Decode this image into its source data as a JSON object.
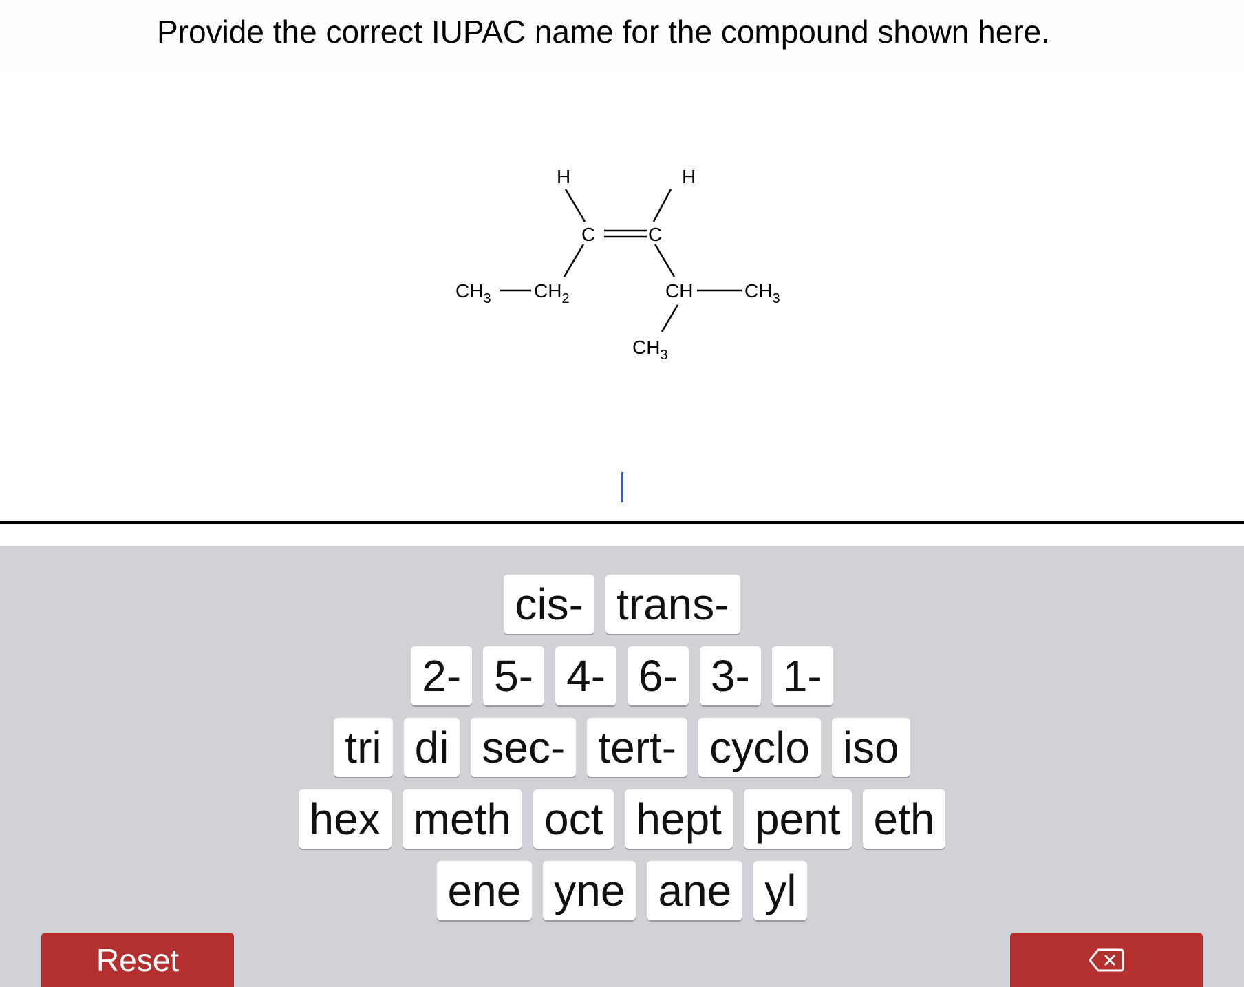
{
  "question": {
    "prompt": "Provide the correct IUPAC name for the compound shown here."
  },
  "structure": {
    "h_left": "H",
    "h_right": "H",
    "c_left": "C",
    "c_right": "C",
    "ch3_left": "CH",
    "ch3_left_sub": "3",
    "ch2": "CH",
    "ch2_sub": "2",
    "ch": "CH",
    "ch3_right": "CH",
    "ch3_right_sub": "3",
    "ch3_bottom": "CH",
    "ch3_bottom_sub": "3"
  },
  "answer": {
    "value": ""
  },
  "keyboard": {
    "row1": [
      "cis-",
      "trans-"
    ],
    "row2": [
      "2-",
      "5-",
      "4-",
      "6-",
      "3-",
      "1-"
    ],
    "row3": [
      "tri",
      "di",
      "sec-",
      "tert-",
      "cyclo",
      "iso"
    ],
    "row4": [
      "hex",
      "meth",
      "oct",
      "hept",
      "pent",
      "eth"
    ],
    "row5": [
      "ene",
      "yne",
      "ane",
      "yl"
    ]
  },
  "controls": {
    "reset_label": "Reset",
    "backspace_icon": "backspace-icon"
  }
}
